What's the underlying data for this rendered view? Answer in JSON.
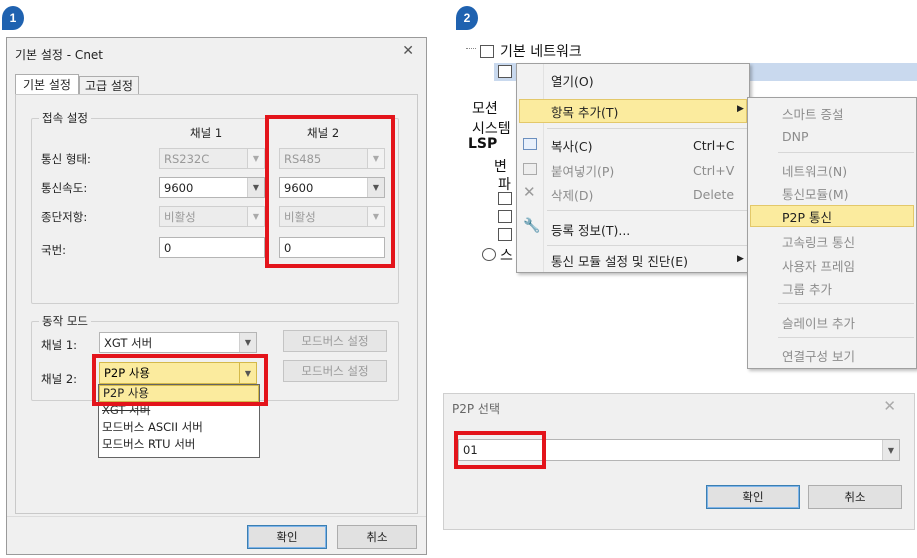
{
  "badges": [
    "1",
    "2"
  ],
  "dialog1": {
    "title": "기본 설정 - Cnet",
    "close_glyph": "✕",
    "tabs": [
      "기본 설정",
      "고급 설정"
    ],
    "connection_group": "접속 설정",
    "channel1_header": "채널 1",
    "channel2_header": "채널 2",
    "rows": [
      {
        "label": "통신 형태:",
        "ch1": "RS232C",
        "ch2": "RS485"
      },
      {
        "label": "통신속도:",
        "ch1": "9600",
        "ch2": "9600"
      },
      {
        "label": "종단저항:",
        "ch1": "비활성",
        "ch2": "비활성"
      },
      {
        "label": "국번:",
        "ch1": "0",
        "ch2": "0"
      }
    ],
    "mode_group": "동작 모드",
    "mode_ch1_label": "채널 1:",
    "mode_ch1_value": "XGT 서버",
    "mode_ch2_label": "채널 2:",
    "mode_ch2_value": "P2P 사용",
    "modbus_btn": "모드버스 설정",
    "dropdown_options": [
      "P2P 사용",
      "XGT 서버",
      "모드버스 ASCII 서버",
      "모드버스 RTU 서버"
    ],
    "ok": "확인",
    "cancel": "취소"
  },
  "tree": {
    "root": "기본 네트워크",
    "partial_items": [
      "모션",
      "시스템",
      "LSP",
      "변",
      "파",
      "스"
    ]
  },
  "context_menu": {
    "items": [
      {
        "label": "열기(O)",
        "shortcut": "",
        "disabled": false,
        "icon": ""
      },
      {
        "label": "항목 추가(T)",
        "shortcut": "",
        "disabled": false,
        "icon": "",
        "submenu": true
      },
      {
        "label": "복사(C)",
        "shortcut": "Ctrl+C",
        "disabled": false,
        "icon": "copy-icon"
      },
      {
        "label": "붙여넣기(P)",
        "shortcut": "Ctrl+V",
        "disabled": true,
        "icon": "paste-icon"
      },
      {
        "label": "삭제(D)",
        "shortcut": "Delete",
        "disabled": true,
        "icon": "delete-icon"
      },
      {
        "label": "등록 정보(T)...",
        "shortcut": "",
        "disabled": false,
        "icon": "wrench-icon"
      },
      {
        "label": "통신 모듈 설정 및 진단(E)",
        "shortcut": "",
        "disabled": false,
        "icon": "",
        "submenu": true
      }
    ]
  },
  "submenu": {
    "items": [
      {
        "label": "스마트 증설",
        "disabled": true
      },
      {
        "label": "DNP",
        "disabled": true
      },
      {
        "label": "네트워크(N)",
        "disabled": true
      },
      {
        "label": "통신모듈(M)",
        "disabled": true
      },
      {
        "label": "P2P 통신",
        "disabled": false,
        "highlighted": true
      },
      {
        "label": "고속링크 통신",
        "disabled": true
      },
      {
        "label": "사용자 프레임",
        "disabled": true
      },
      {
        "label": "그룹 추가",
        "disabled": true
      },
      {
        "label": "슬레이브 추가",
        "disabled": true
      },
      {
        "label": "연결구성 보기",
        "disabled": true
      }
    ]
  },
  "dialog2": {
    "title": "P2P 선택",
    "close_glyph": "✕",
    "combo_value": "01",
    "ok": "확인",
    "cancel": "취소"
  },
  "colors": {
    "badge": "#1f62b0",
    "highlight_box": "#e3141b",
    "selection": "#fbeb9e"
  }
}
